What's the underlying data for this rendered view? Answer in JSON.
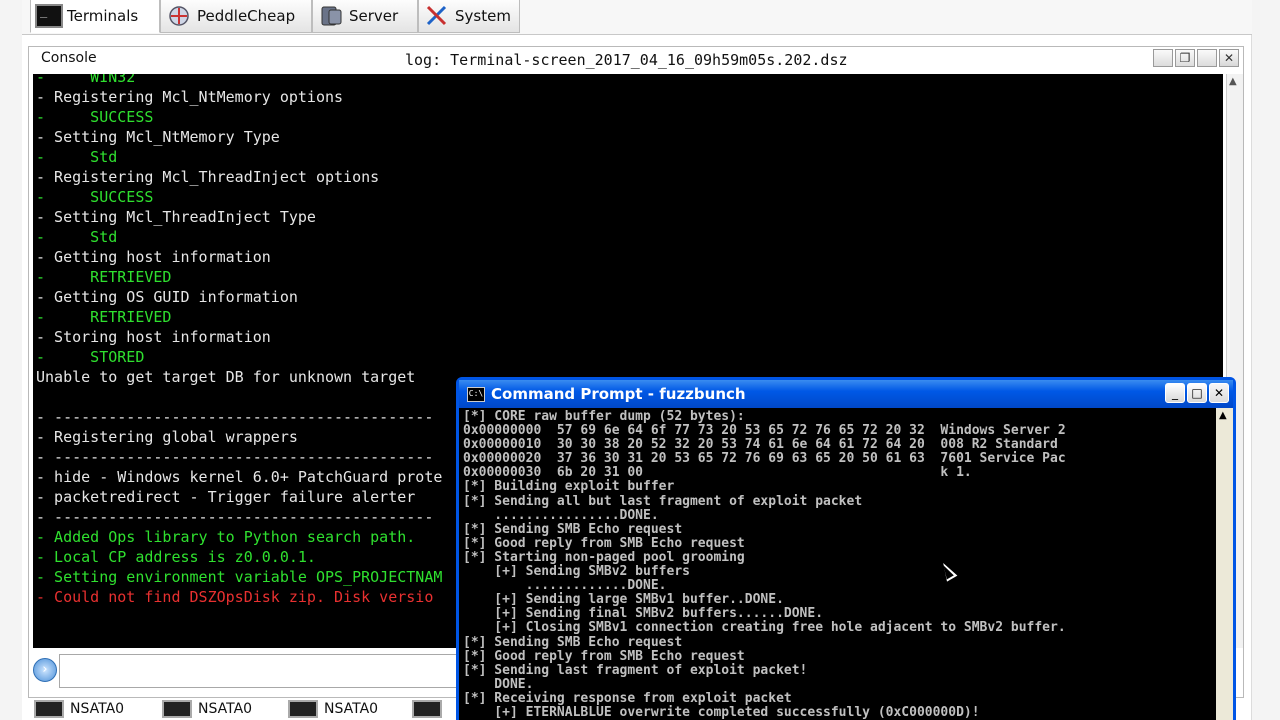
{
  "tabs": [
    {
      "label": "Terminals",
      "icon": "terminal-icon",
      "active": true
    },
    {
      "label": "PeddleCheap",
      "icon": "peddlecheap-icon",
      "active": false
    },
    {
      "label": "Server",
      "icon": "server-icon",
      "active": false
    },
    {
      "label": "System",
      "icon": "system-icon",
      "active": false
    }
  ],
  "console": {
    "label": "Console",
    "log_title": "log: Terminal-screen_2017_04_16_09h59m05s.202.dsz",
    "controls": {
      "restore": "❐",
      "close": "✕"
    }
  },
  "terminal_lines": [
    {
      "text": "-     WIN32",
      "color": "g"
    },
    {
      "text": "- Registering Mcl_NtMemory options",
      "color": "w"
    },
    {
      "text": "-     SUCCESS",
      "color": "g"
    },
    {
      "text": "- Setting Mcl_NtMemory Type",
      "color": "w"
    },
    {
      "text": "-     Std",
      "color": "g"
    },
    {
      "text": "- Registering Mcl_ThreadInject options",
      "color": "w"
    },
    {
      "text": "-     SUCCESS",
      "color": "g"
    },
    {
      "text": "- Setting Mcl_ThreadInject Type",
      "color": "w"
    },
    {
      "text": "-     Std",
      "color": "g"
    },
    {
      "text": "- Getting host information",
      "color": "w"
    },
    {
      "text": "-     RETRIEVED",
      "color": "g"
    },
    {
      "text": "- Getting OS GUID information",
      "color": "w"
    },
    {
      "text": "-     RETRIEVED",
      "color": "g"
    },
    {
      "text": "- Storing host information",
      "color": "w"
    },
    {
      "text": "-     STORED",
      "color": "g"
    },
    {
      "text": "Unable to get target DB for unknown target",
      "color": "w"
    },
    {
      "text": "",
      "color": "w"
    },
    {
      "text": "- ------------------------------------------",
      "color": "w"
    },
    {
      "text": "- Registering global wrappers",
      "color": "w"
    },
    {
      "text": "- ------------------------------------------",
      "color": "w"
    },
    {
      "text": "- hide - Windows kernel 6.0+ PatchGuard prote",
      "color": "w"
    },
    {
      "text": "- packetredirect - Trigger failure alerter",
      "color": "w"
    },
    {
      "text": "- ------------------------------------------",
      "color": "w"
    },
    {
      "text": "- Added Ops library to Python search path.",
      "color": "g"
    },
    {
      "text": "- Local CP address is z0.0.0.1.",
      "color": "g"
    },
    {
      "text": "- Setting environment variable OPS_PROJECTNAM",
      "color": "g"
    },
    {
      "text": "- Could not find DSZOpsDisk zip. Disk versio",
      "color": "r"
    }
  ],
  "bottom_tabs": [
    {
      "label": "NSATA0"
    },
    {
      "label": "NSATA0"
    },
    {
      "label": "NSATA0"
    },
    {
      "label": ""
    }
  ],
  "cmd_window": {
    "title": "Command Prompt - fuzzbunch",
    "icon_text": "C:\\",
    "controls": {
      "minimize": "_",
      "maximize": "□",
      "close": "✕"
    },
    "lines": [
      "[*] CORE raw buffer dump (52 bytes):",
      "0x00000000  57 69 6e 64 6f 77 73 20 53 65 72 76 65 72 20 32  Windows Server 2",
      "0x00000010  30 30 38 20 52 32 20 53 74 61 6e 64 61 72 64 20  008 R2 Standard ",
      "0x00000020  37 36 30 31 20 53 65 72 76 69 63 65 20 50 61 63  7601 Service Pac",
      "0x00000030  6b 20 31 00                                      k 1.",
      "[*] Building exploit buffer",
      "[*] Sending all but last fragment of exploit packet",
      "    ................DONE.",
      "[*] Sending SMB Echo request",
      "[*] Good reply from SMB Echo request",
      "[*] Starting non-paged pool grooming",
      "    [+] Sending SMBv2 buffers",
      "        .............DONE.",
      "    [+] Sending large SMBv1 buffer..DONE.",
      "    [+] Sending final SMBv2 buffers......DONE.",
      "    [+] Closing SMBv1 connection creating free hole adjacent to SMBv2 buffer.",
      "[*] Sending SMB Echo request",
      "[*] Good reply from SMB Echo request",
      "[*] Sending last fragment of exploit packet!",
      "    DONE.",
      "[*] Receiving response from exploit packet",
      "    [+] ETERNALBLUE overwrite completed successfully (0xC000000D)!"
    ]
  }
}
